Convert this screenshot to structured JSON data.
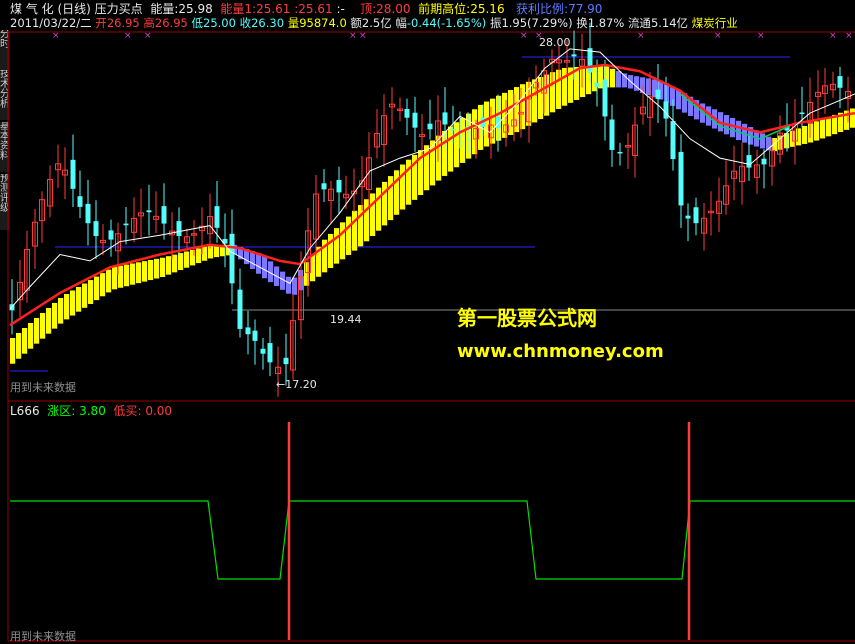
{
  "header": {
    "name": "煤 气 化",
    "period": "(日线)",
    "indicator": "压力买点",
    "energy_label": "能量:",
    "energy_value": "25.98",
    "energy1_label": "能量1:",
    "energy1_a": "25.61",
    "energy1_b": "25.61",
    "energy1_c": ":-",
    "top_label": "顶:",
    "top_value": "28.00",
    "prev_high_label": "前期高位:",
    "prev_high_value": "25.16",
    "profit_label": "获利比例:",
    "profit_value": "77.90"
  },
  "quote": {
    "date": "2011/03/22/二",
    "open_label": "开",
    "open": "26.95",
    "high_label": "高",
    "high": "26.95",
    "low_label": "低",
    "low": "25.00",
    "close_label": "收",
    "close": "26.30",
    "vol_label": "量",
    "vol": "95874.0",
    "amount_label": "额",
    "amount": "2.5亿",
    "range_label": "幅",
    "range": "-0.44(-1.65%)",
    "amp_label": "振",
    "amp": "1.95(7.29%)",
    "turnover_label": "换",
    "turnover": "1.87%",
    "float_label": "流通",
    "float": "5.14亿",
    "sector": "煤炭行业"
  },
  "side_tabs": [
    "分时",
    "技术分析",
    "基本资料",
    "预测评级"
  ],
  "annotations": {
    "price_high": "28.00",
    "price_mid": "19.44",
    "price_low": "←17.20",
    "future_top": "用到未来数据",
    "future_bottom": "用到未来数据"
  },
  "watermark": {
    "line1": "第一股票公式网",
    "line2": "www.chnmoney.com"
  },
  "sub": {
    "name": "L666",
    "rise_label": "涨区:",
    "rise_value": "3.80",
    "buy_label": "低买:",
    "buy_value": "0.00"
  },
  "colors": {
    "up": "#ff3c3c",
    "down": "#54fcfc",
    "band_up": "#ffff00",
    "band_down": "#7b78ff",
    "ma_red": "#ff2020",
    "ma_white": "#ffffff",
    "signal": "#00e000",
    "level": "#2828ff"
  }
}
